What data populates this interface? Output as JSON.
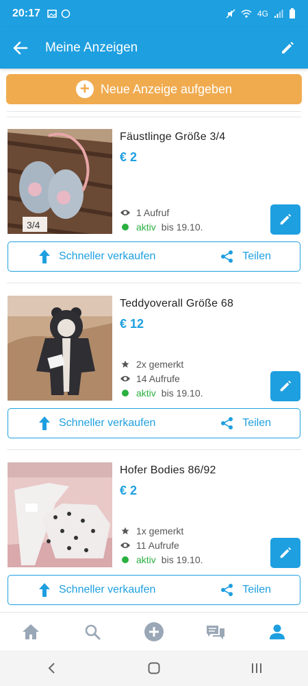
{
  "status_bar": {
    "time": "20:17",
    "network": "4G"
  },
  "app_bar": {
    "title": "Meine Anzeigen"
  },
  "new_ad_button": {
    "label": "Neue Anzeige aufgeben"
  },
  "listings": [
    {
      "title": "Fäustlinge Größe 3/4",
      "price": "€ 2",
      "image_label": "3/4",
      "views": "1 Aufruf",
      "status": "aktiv",
      "status_until": "bis 19.10.",
      "sell_faster": "Schneller verkaufen",
      "share": "Teilen"
    },
    {
      "title": "Teddyoverall Größe 68",
      "price": "€ 12",
      "saved": "2x gemerkt",
      "views": "14 Aufrufe",
      "status": "aktiv",
      "status_until": "bis 19.10.",
      "sell_faster": "Schneller verkaufen",
      "share": "Teilen"
    },
    {
      "title": "Hofer Bodies 86/92",
      "price": "€ 2",
      "saved": "1x gemerkt",
      "views": "11 Aufrufe",
      "status": "aktiv",
      "status_until": "bis 19.10.",
      "sell_faster": "Schneller verkaufen",
      "share": "Teilen"
    }
  ],
  "bottom_nav": [
    "home-icon",
    "search-icon",
    "add-icon",
    "messages-icon",
    "profile-icon"
  ],
  "colors": {
    "primary": "#1e9fe0",
    "accent": "#f0ab4f",
    "active": "#2ab040"
  }
}
